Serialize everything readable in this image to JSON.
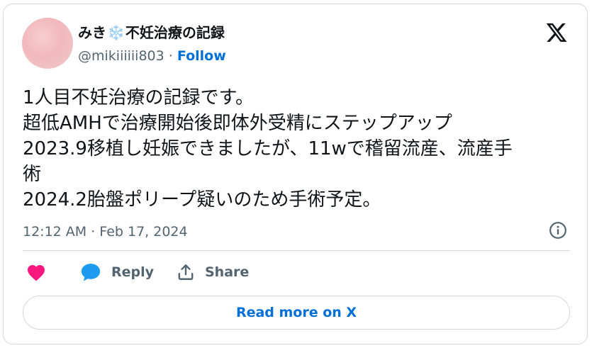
{
  "author": {
    "name_prefix": "みき",
    "name_emoji": "❄️",
    "name_suffix": "不妊治療の記録",
    "handle": "@mikiiiiii803",
    "separator": "·",
    "follow_label": "Follow"
  },
  "tweet": {
    "lines": [
      "1人目不妊治療の記録です。",
      "超低AMHで治療開始後即体外受精にステップアップ",
      "2023.9移植し妊娠できましたが、11wで稽留流産、流産手",
      "術",
      "2024.2胎盤ポリープ疑いのため手術予定。"
    ],
    "timestamp": "12:12 AM · Feb 17, 2024"
  },
  "actions": {
    "reply_label": "Reply",
    "share_label": "Share"
  },
  "read_more_label": "Read more on X",
  "colors": {
    "like": "#f91880",
    "reply": "#1d9bf0",
    "link": "#006fd6",
    "secondary_text": "#536471",
    "border": "#cfd9de"
  },
  "icons": {
    "logo": "x-logo-icon",
    "info": "info-icon",
    "like": "heart-icon",
    "reply": "speech-bubble-icon",
    "share": "share-upload-icon"
  }
}
